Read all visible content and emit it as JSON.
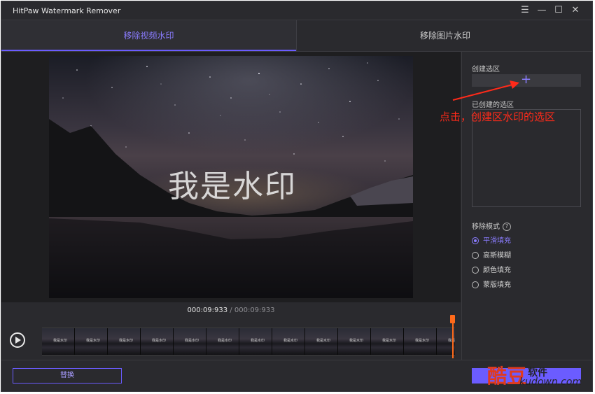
{
  "app": {
    "title": "HitPaw Watermark Remover"
  },
  "window_controls": {
    "menu": "☰",
    "minimize": "—",
    "maximize": "☐",
    "close": "✕"
  },
  "tabs": [
    {
      "label": "移除视频水印",
      "active": true
    },
    {
      "label": "移除图片水印",
      "active": false
    }
  ],
  "preview": {
    "watermark_text": "我是水印"
  },
  "player": {
    "current_time": "000:09:933",
    "separator": " / ",
    "total_time": "000:09:933"
  },
  "filmstrip": {
    "thumb_text": "我是水印",
    "thumb_count": 13
  },
  "right_panel": {
    "create_selection_label": "创建选区",
    "add_icon": "+",
    "created_selection_label": "已创建的选区",
    "removal_mode_label": "移除模式",
    "help_icon": "?",
    "modes": [
      {
        "label": "平滑填充",
        "selected": true
      },
      {
        "label": "高斯模糊",
        "selected": false
      },
      {
        "label": "颜色填充",
        "selected": false
      },
      {
        "label": "蒙版填充",
        "selected": false
      }
    ]
  },
  "annotation": {
    "text": "点击，创建区水印的选区",
    "color": "#ff2a1a"
  },
  "bottom": {
    "replace_label": "替换"
  },
  "site_logo": {
    "main": "酷豆",
    "cn": "软件",
    "url": "kudown.com"
  },
  "colors": {
    "accent": "#6b5cff",
    "accent_text": "#8a7cff",
    "playhead": "#ff6a1a"
  }
}
